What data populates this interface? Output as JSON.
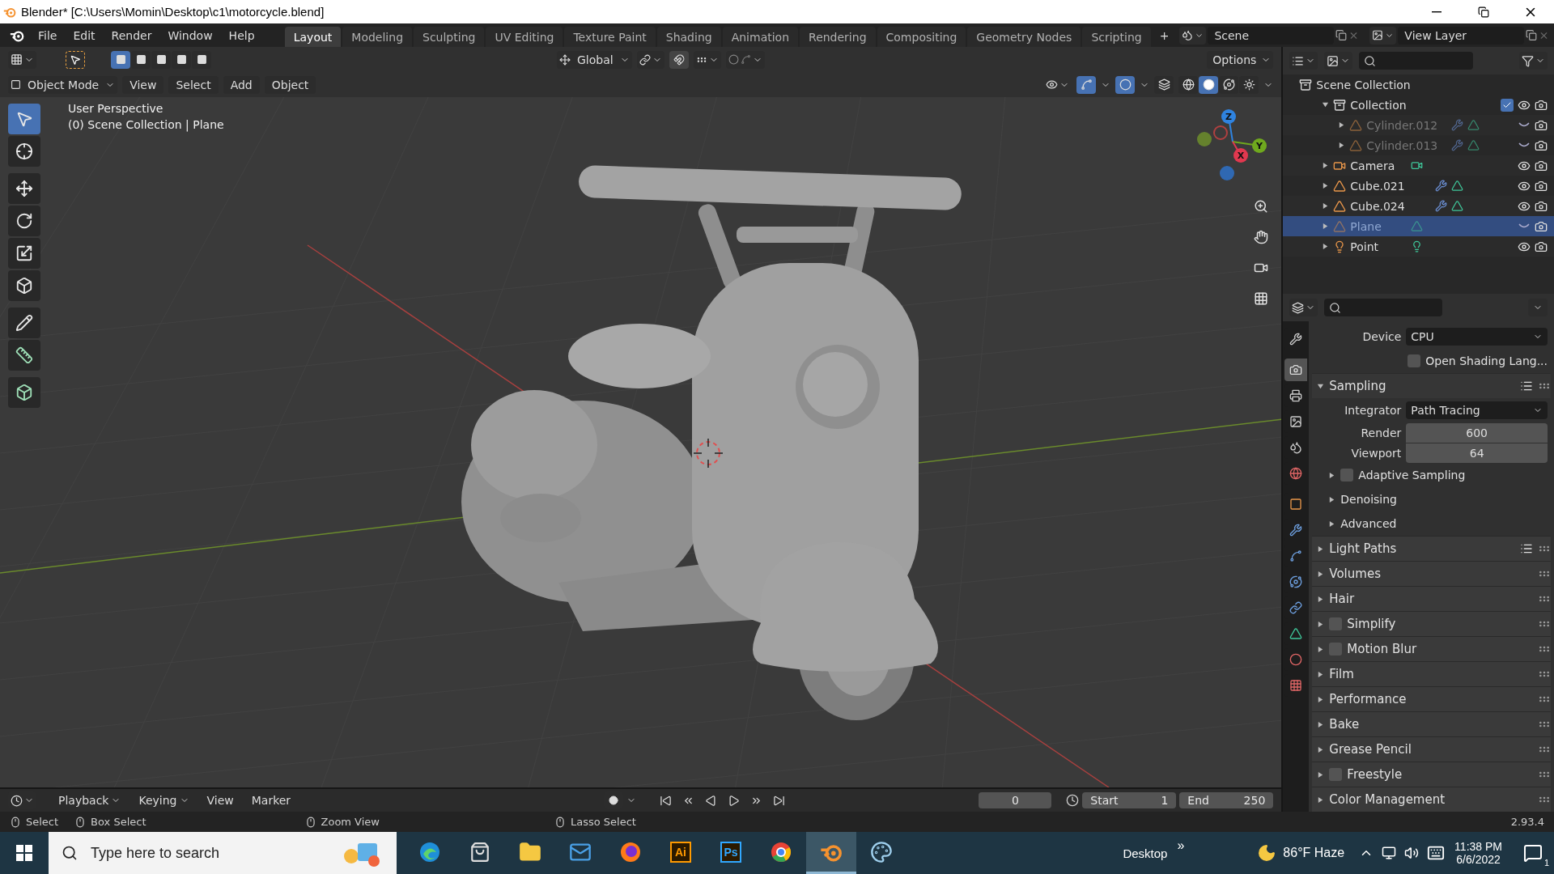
{
  "window": {
    "title": "Blender* [C:\\Users\\Momin\\Desktop\\c1\\motorcycle.blend]"
  },
  "menu": [
    "File",
    "Edit",
    "Render",
    "Window",
    "Help"
  ],
  "workspaces": [
    {
      "label": "Layout",
      "selected": true
    },
    {
      "label": "Modeling",
      "selected": false
    },
    {
      "label": "Sculpting",
      "selected": false
    },
    {
      "label": "UV Editing",
      "selected": false
    },
    {
      "label": "Texture Paint",
      "selected": false
    },
    {
      "label": "Shading",
      "selected": false
    },
    {
      "label": "Animation",
      "selected": false
    },
    {
      "label": "Rendering",
      "selected": false
    },
    {
      "label": "Compositing",
      "selected": false
    },
    {
      "label": "Geometry Nodes",
      "selected": false
    },
    {
      "label": "Scripting",
      "selected": false
    }
  ],
  "add_workspace": "+",
  "scene": "Scene",
  "view_layer": "View Layer",
  "viewport": {
    "select_modes": [
      {
        "selected": true
      },
      {
        "selected": false
      },
      {
        "selected": false
      },
      {
        "selected": false
      },
      {
        "selected": false
      }
    ],
    "orientation": "Global",
    "options": "Options",
    "mode": "Object Mode",
    "menus": [
      "View",
      "Select",
      "Add",
      "Object"
    ],
    "shading": [
      {
        "kind": "wireframe",
        "selected": false
      },
      {
        "kind": "solid",
        "selected": true
      },
      {
        "kind": "material",
        "selected": false
      },
      {
        "kind": "rendered",
        "selected": false
      }
    ],
    "overlay_text": [
      "User Perspective",
      "(0) Scene Collection | Plane"
    ],
    "tools": [
      {
        "kind": "select",
        "selected": true
      },
      {
        "kind": "cursor",
        "selected": false
      },
      {
        "kind": "move",
        "selected": false
      },
      {
        "kind": "rotate",
        "selected": false
      },
      {
        "kind": "scale",
        "selected": false
      },
      {
        "kind": "transform",
        "selected": false
      },
      {
        "kind": "annotate",
        "selected": false
      },
      {
        "kind": "measure",
        "selected": false
      },
      {
        "kind": "add-cube",
        "selected": false
      }
    ],
    "gizmo": [
      {
        "label": "Z",
        "color": "#2f83e0"
      },
      {
        "label": "Y",
        "color": "#6fa81e"
      },
      {
        "label": "X",
        "color": "#e0384f"
      }
    ]
  },
  "outliner": {
    "root": "Scene Collection",
    "items": [
      {
        "name": "Collection",
        "kind": "collection",
        "expanded": true,
        "checked": true,
        "visible": true,
        "selected": false,
        "children": [
          {
            "name": "Cylinder.012",
            "kind": "mesh",
            "expanded": false,
            "visible": false,
            "selected": false,
            "modifiers": true
          },
          {
            "name": "Cylinder.013",
            "kind": "mesh",
            "expanded": false,
            "visible": false,
            "selected": false,
            "modifiers": true
          }
        ]
      },
      {
        "name": "Camera",
        "kind": "camera",
        "expanded": false,
        "visible": true,
        "selected": false,
        "modifiers": false
      },
      {
        "name": "Cube.021",
        "kind": "mesh",
        "expanded": false,
        "visible": true,
        "selected": false,
        "modifiers": true
      },
      {
        "name": "Cube.024",
        "kind": "mesh",
        "expanded": false,
        "visible": true,
        "selected": false,
        "modifiers": true
      },
      {
        "name": "Plane",
        "kind": "mesh",
        "expanded": false,
        "visible": false,
        "selected": true,
        "modifiers": false
      },
      {
        "name": "Point",
        "kind": "light",
        "expanded": false,
        "visible": true,
        "selected": false,
        "modifiers": false
      }
    ]
  },
  "properties": {
    "tabs": [
      {
        "kind": "tool",
        "selected": false
      },
      {
        "kind": "render",
        "selected": true
      },
      {
        "kind": "output",
        "selected": false
      },
      {
        "kind": "view_layer",
        "selected": false
      },
      {
        "kind": "scene",
        "selected": false
      },
      {
        "kind": "world",
        "selected": false
      },
      {
        "kind": "object",
        "selected": false
      },
      {
        "kind": "modifiers",
        "selected": false
      },
      {
        "kind": "particles",
        "selected": false
      },
      {
        "kind": "physics",
        "selected": false
      },
      {
        "kind": "constraints",
        "selected": false
      },
      {
        "kind": "data",
        "selected": false
      },
      {
        "kind": "material",
        "selected": false
      },
      {
        "kind": "texture",
        "selected": false
      }
    ],
    "device_label": "Device",
    "device": "CPU",
    "osl": {
      "label": "Open Shading Lang...",
      "checked": false
    },
    "panels": [
      {
        "title": "Sampling",
        "expanded": true,
        "presets": true,
        "fields": [
          {
            "kind": "select",
            "label": "Integrator",
            "value": "Path Tracing"
          },
          {
            "kind": "number",
            "label": "Render",
            "value": "600"
          },
          {
            "kind": "number",
            "label": "Viewport",
            "value": "64"
          }
        ],
        "subpanels": [
          {
            "title": "Adaptive Sampling",
            "checked": false
          },
          {
            "title": "Denoising"
          },
          {
            "title": "Advanced"
          }
        ]
      },
      {
        "title": "Light Paths",
        "expanded": false,
        "presets": true
      },
      {
        "title": "Volumes",
        "expanded": false,
        "presets": false
      },
      {
        "title": "Hair",
        "expanded": false,
        "presets": false
      },
      {
        "title": "Simplify",
        "expanded": false,
        "presets": false,
        "checked": false
      },
      {
        "title": "Motion Blur",
        "expanded": false,
        "presets": false,
        "checked": false
      },
      {
        "title": "Film",
        "expanded": false,
        "presets": false
      },
      {
        "title": "Performance",
        "expanded": false,
        "presets": false
      },
      {
        "title": "Bake",
        "expanded": false,
        "presets": false
      },
      {
        "title": "Grease Pencil",
        "expanded": false,
        "presets": false
      },
      {
        "title": "Freestyle",
        "expanded": false,
        "presets": false,
        "checked": false
      },
      {
        "title": "Color Management",
        "expanded": false,
        "presets": false
      }
    ]
  },
  "timeline": {
    "menus": [
      {
        "label": "Playback",
        "dropdown": true
      },
      {
        "label": "Keying",
        "dropdown": true
      },
      {
        "label": "View",
        "dropdown": false
      },
      {
        "label": "Marker",
        "dropdown": false
      }
    ],
    "frame": "0",
    "start_label": "Start",
    "start": "1",
    "end_label": "End",
    "end": "250"
  },
  "status_bar": {
    "items": [
      "Select",
      "Box Select",
      "Zoom View",
      "Lasso Select"
    ],
    "version": "2.93.4"
  },
  "taskbar": {
    "search": {
      "placeholder": "Type here to search"
    },
    "apps": [
      {
        "kind": "edge",
        "selected": false
      },
      {
        "kind": "store",
        "selected": false
      },
      {
        "kind": "explorer",
        "selected": false
      },
      {
        "kind": "mail",
        "selected": false
      },
      {
        "kind": "firefox",
        "selected": false
      },
      {
        "kind": "text",
        "text": "Ai",
        "color": "#ff9a00",
        "selected": false
      },
      {
        "kind": "text",
        "text": "Ps",
        "color": "#31a8ff",
        "selected": false
      },
      {
        "kind": "chrome",
        "selected": false
      },
      {
        "kind": "blender",
        "selected": true
      },
      {
        "kind": "paint",
        "selected": false
      }
    ],
    "desktop": "Desktop",
    "more": "»",
    "weather": "86°F  Haze",
    "time": "11:38 PM",
    "date": "6/6/2022",
    "notifications": "1"
  }
}
